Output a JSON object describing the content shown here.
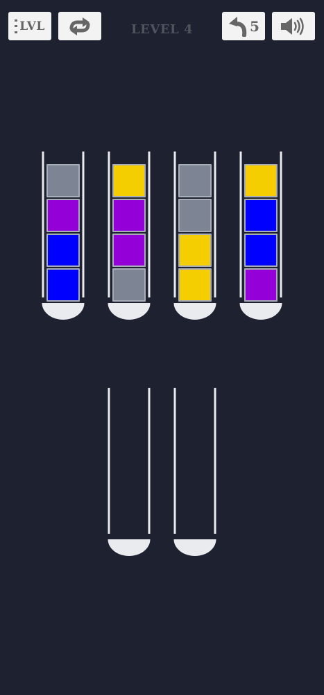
{
  "header": {
    "level_button_label": "LVL",
    "level_title": "LEVEL 4",
    "undo_count": "5",
    "icons": {
      "level_menu": "menu-lines-icon",
      "restart": "restart-arrows-icon",
      "undo": "undo-arrow-icon",
      "sound": "speaker-icon"
    }
  },
  "palette": {
    "gray": "#7d8594",
    "purple": "#9400d8",
    "blue": "#0000ff",
    "yellow": "#f4ce00",
    "tube": "#e9ebee",
    "background": "#1d2130"
  },
  "tubes": [
    {
      "id": "tube-1",
      "balls_top_to_bottom": [
        "gray",
        "purple",
        "blue",
        "blue"
      ]
    },
    {
      "id": "tube-2",
      "balls_top_to_bottom": [
        "yellow",
        "purple",
        "purple",
        "gray"
      ]
    },
    {
      "id": "tube-3",
      "balls_top_to_bottom": [
        "gray",
        "gray",
        "yellow",
        "yellow"
      ]
    },
    {
      "id": "tube-4",
      "balls_top_to_bottom": [
        "yellow",
        "blue",
        "blue",
        "purple"
      ]
    },
    {
      "id": "tube-5",
      "balls_top_to_bottom": []
    },
    {
      "id": "tube-6",
      "balls_top_to_bottom": []
    }
  ]
}
